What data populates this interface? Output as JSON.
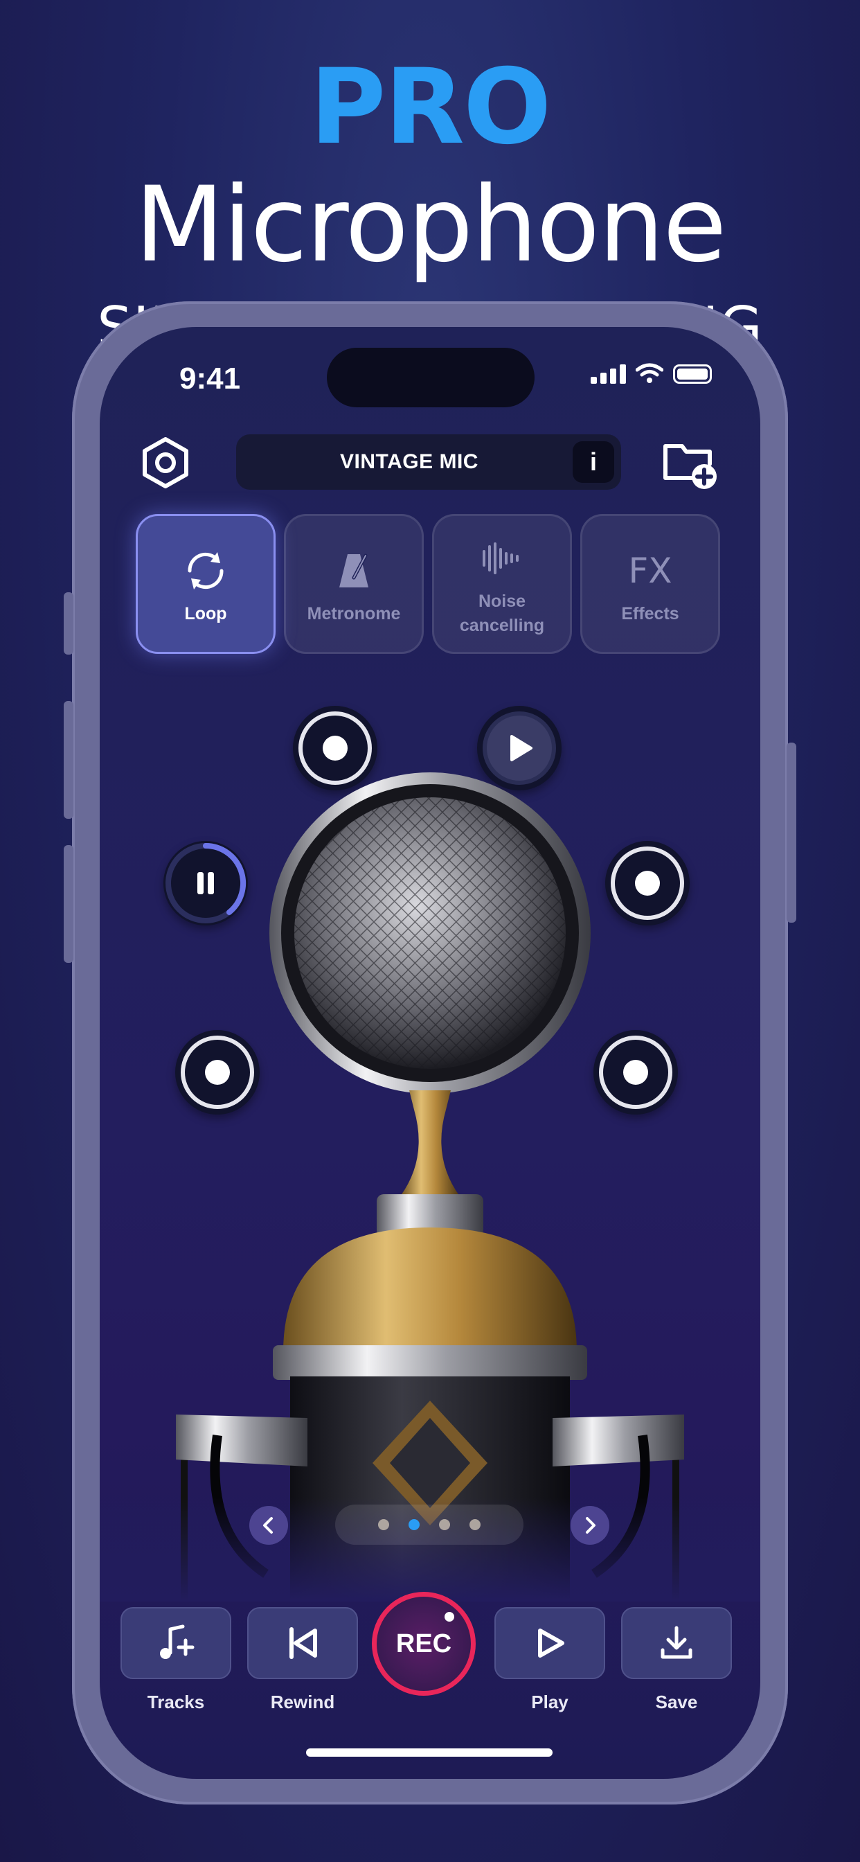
{
  "headline": {
    "pro": "PRO",
    "title": "Microphone",
    "subtitle": "SINGING & RECORDING STUDIO"
  },
  "status_bar": {
    "time": "9:41"
  },
  "topbar": {
    "preset_name": "VINTAGE MIC",
    "info_label": "i",
    "settings_icon": "settings-icon",
    "add_folder_icon": "folder-add-icon"
  },
  "modes": [
    {
      "label": "Loop",
      "icon": "loop-icon",
      "active": true
    },
    {
      "label": "Metronome",
      "icon": "metronome-icon",
      "active": false
    },
    {
      "label": "Noise cancelling",
      "label_l1": "Noise",
      "label_l2": "cancelling",
      "icon": "waveform-icon",
      "active": false
    },
    {
      "label": "Effects",
      "icon_text": "FX",
      "active": false
    }
  ],
  "pager": {
    "pages": 4,
    "current": 2
  },
  "controls": {
    "tracks": "Tracks",
    "rewind": "Rewind",
    "rec": "REC",
    "play": "Play",
    "save": "Save"
  },
  "colors": {
    "accent_blue": "#2a9df4",
    "rec_red": "#e9265a",
    "active_mode": "#444a97"
  }
}
